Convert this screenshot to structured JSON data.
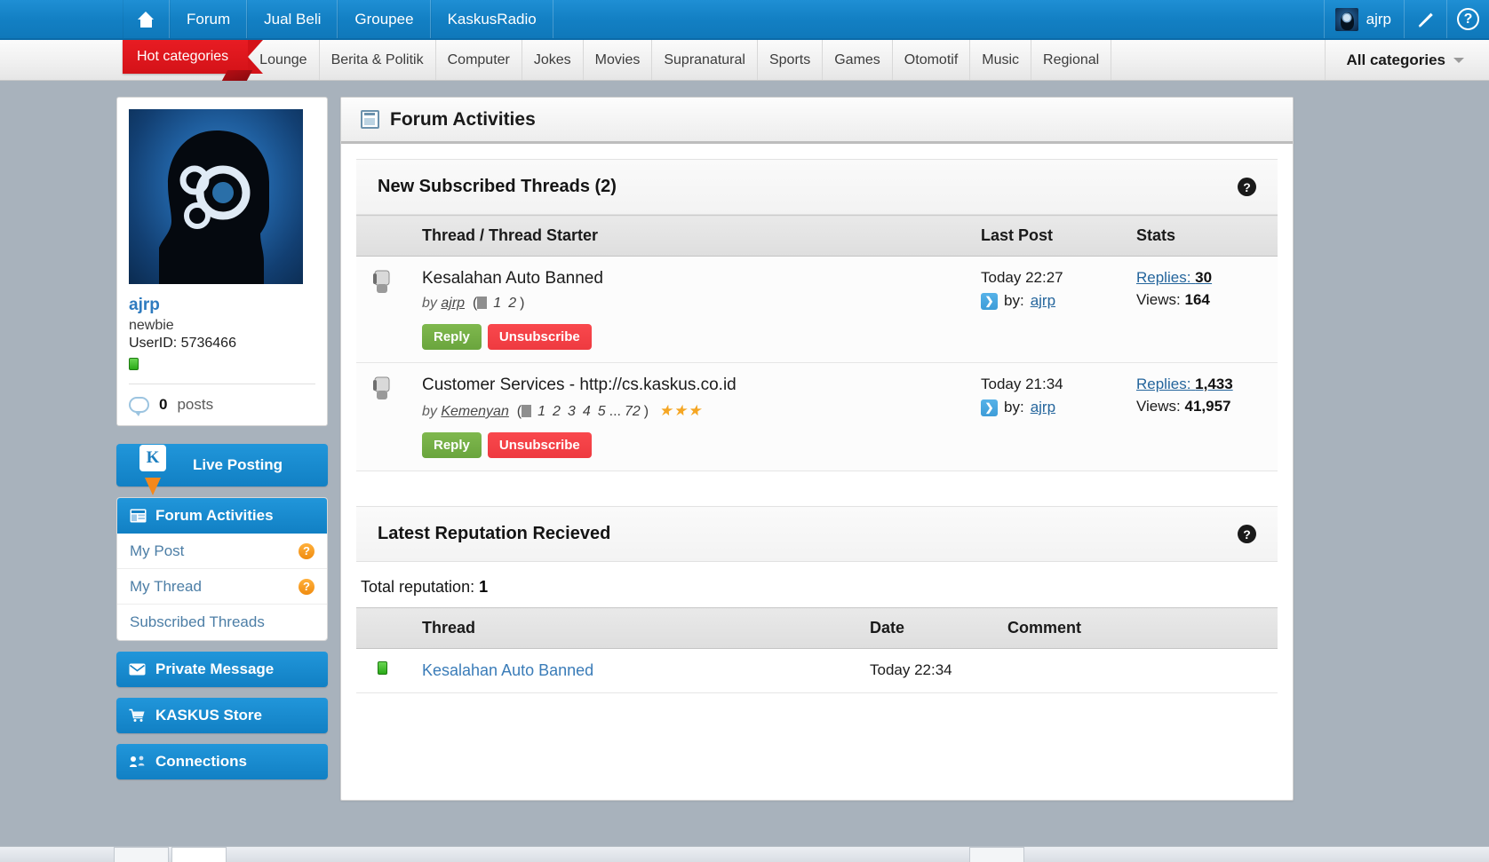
{
  "topbar": {
    "home_icon": "home-icon",
    "items": [
      {
        "label": "Forum"
      },
      {
        "label": "Jual Beli"
      },
      {
        "label": "Groupee"
      },
      {
        "label": "KaskusRadio"
      }
    ],
    "user": {
      "name": "ajrp",
      "avatar_icon": "user-avatar-icon"
    },
    "compose_icon": "pencil-icon",
    "help_icon": "question-mark-icon",
    "help_label": "?"
  },
  "catnav": {
    "hot_tab": "Hot categories",
    "items": [
      {
        "label": "Lounge"
      },
      {
        "label": "Berita & Politik"
      },
      {
        "label": "Computer"
      },
      {
        "label": "Jokes"
      },
      {
        "label": "Movies"
      },
      {
        "label": "Supranatural"
      },
      {
        "label": "Sports"
      },
      {
        "label": "Games"
      },
      {
        "label": "Otomotif"
      },
      {
        "label": "Music"
      },
      {
        "label": "Regional"
      }
    ],
    "all_categories": "All categories",
    "caret_icon": "chevron-down-icon"
  },
  "sidebar": {
    "profile": {
      "avatar_icon": "head-with-gears-avatar",
      "username": "ajrp",
      "rank": "newbie",
      "userid_label": "UserID: 5736466",
      "status_icon": "green-status-chip",
      "posts_icon": "speech-bubble-icon",
      "posts_count": "0",
      "posts_label": "posts"
    },
    "live_posting": {
      "label": "Live Posting",
      "icon": "kaskus-balloon-icon"
    },
    "forum_activities": {
      "label": "Forum Activities",
      "icon": "forum-activities-icon",
      "sub_items": [
        {
          "label": "My Post",
          "badge": "?"
        },
        {
          "label": "My Thread",
          "badge": "?"
        },
        {
          "label": "Subscribed Threads",
          "badge": ""
        }
      ]
    },
    "buttons": [
      {
        "label": "Private Message",
        "icon": "envelope-icon"
      },
      {
        "label": "KASKUS Store",
        "icon": "shopping-cart-icon"
      },
      {
        "label": "Connections",
        "icon": "connections-icon"
      }
    ]
  },
  "main": {
    "page_title": "Forum Activities",
    "page_icon": "forum-activities-icon",
    "subscribed": {
      "section_title": "New Subscribed Threads (2)",
      "help_label": "?",
      "columns": [
        "Thread / Thread Starter",
        "Last Post",
        "Stats"
      ],
      "rows": [
        {
          "icon": "thread-status-icon",
          "title": "Kesalahan Auto Banned",
          "by_prefix": "by",
          "starter": "ajrp",
          "pages": [
            "1",
            "2"
          ],
          "pages_ellipsis": "",
          "pages_last": "",
          "stars": "",
          "reply_label": "Reply",
          "unsubscribe_label": "Unsubscribe",
          "last_post_time": "Today 22:27",
          "last_post_by_label": "by:",
          "last_post_by": "ajrp",
          "replies_label": "Replies:",
          "replies_count": "30",
          "views_label": "Views:",
          "views_count": "164"
        },
        {
          "icon": "thread-status-icon",
          "title": "Customer Services - http://cs.kaskus.co.id",
          "by_prefix": "by",
          "starter": "Kemenyan",
          "pages": [
            "1",
            "2",
            "3",
            "4",
            "5"
          ],
          "pages_ellipsis": "...",
          "pages_last": "72",
          "stars": "★★★",
          "reply_label": "Reply",
          "unsubscribe_label": "Unsubscribe",
          "last_post_time": "Today 21:34",
          "last_post_by_label": "by:",
          "last_post_by": "ajrp",
          "replies_label": "Replies:",
          "replies_count": "1,433",
          "views_label": "Views:",
          "views_count": "41,957"
        }
      ]
    },
    "reputation": {
      "section_title": "Latest Reputation Recieved",
      "help_label": "?",
      "total_label": "Total reputation:",
      "total_value": "1",
      "columns": [
        "Thread",
        "Date",
        "Comment"
      ],
      "rows": [
        {
          "chip_icon": "green-reputation-chip",
          "thread": "Kesalahan Auto Banned",
          "date": "Today 22:34",
          "comment": ""
        }
      ]
    }
  },
  "colors": {
    "brand_blue": "#1180c4",
    "hot_red": "#d41218",
    "reply_green": "#6aa53d",
    "unsub_red": "#ee3a40",
    "link_blue": "#24659c",
    "badge_orange": "#f08c10"
  }
}
